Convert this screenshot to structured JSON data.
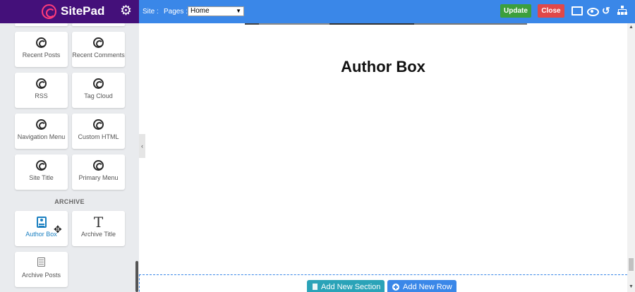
{
  "brand": {
    "name": "SitePad"
  },
  "sidebar": {
    "widgets": [
      {
        "label": "Recent Posts"
      },
      {
        "label": "Recent Comments"
      },
      {
        "label": "RSS"
      },
      {
        "label": "Tag Cloud"
      },
      {
        "label": "Navigation Menu"
      },
      {
        "label": "Custom HTML"
      },
      {
        "label": "Site Title"
      },
      {
        "label": "Primary Menu"
      }
    ],
    "archive_heading": "ARCHIVE",
    "archive_widgets": [
      {
        "label": "Author Box"
      },
      {
        "label": "Archive Title"
      },
      {
        "label": "Archive Posts"
      }
    ]
  },
  "topbar": {
    "site_label": "Site :",
    "pages_label": "Pages :",
    "pages_selected": "Home",
    "update_label": "Update",
    "close_label": "Close"
  },
  "canvas": {
    "heading": "Author Box",
    "add_section_label": "Add New Section",
    "add_row_label": "Add New Row"
  },
  "colors": {
    "brand_bg": "#44107a",
    "topbar_bg": "#3a87e8",
    "update_bg": "#3c9f3c",
    "close_bg": "#e04848",
    "add_section_bg": "#2aa3b8",
    "add_row_bg": "#3a87e8"
  }
}
